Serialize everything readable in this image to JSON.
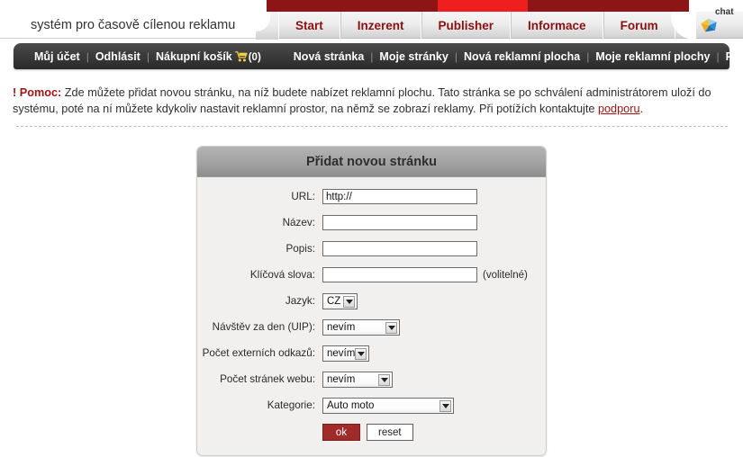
{
  "topbar": {
    "brand_text": "systém pro časově cílenou reklamu",
    "accent_dark_red": "#8e1515",
    "accent_bright_red": "#ef1f1f",
    "tabs": [
      {
        "label": "Start",
        "active": false
      },
      {
        "label": "Inzerent",
        "active": false
      },
      {
        "label": "Publisher",
        "active": true
      },
      {
        "label": "Informace",
        "active": false
      },
      {
        "label": "Forum",
        "active": false
      }
    ],
    "chat_label": "chat"
  },
  "subnav": {
    "left_items": [
      {
        "label": "Můj účet"
      },
      {
        "label": "Odhlásit"
      },
      {
        "label": "Nákupní košík"
      }
    ],
    "cart_count": "(0)",
    "separator": "|",
    "right_items": [
      {
        "label": "Nová stránka"
      },
      {
        "label": "Moje stránky"
      },
      {
        "label": "Nová reklamní plocha"
      },
      {
        "label": "Moje reklamní plochy"
      },
      {
        "label": "Poptávka webů"
      }
    ]
  },
  "help": {
    "prefix": "! Pomoc:",
    "body_before_link": " Zde můžete přidat novou stránku, na níž budete nabízet reklamní plochu. Tato stránka se po schválení administrátorem uloží do systému, poté na ní můžete kdykoliv nastavit reklamní prostor, na němž se zobrazí reklamy. Při potížích kontaktujte ",
    "link_text": "podporu",
    "body_after_link": "."
  },
  "form": {
    "title": "Přidat novou stránku",
    "fields": {
      "url": {
        "label": "URL:",
        "value": "http://"
      },
      "nazev": {
        "label": "Název:",
        "value": ""
      },
      "popis": {
        "label": "Popis:",
        "value": ""
      },
      "klicova_slova": {
        "label": "Klíčová slova:",
        "value": "",
        "note": "(volitelné)"
      },
      "jazyk": {
        "label": "Jazyk:",
        "value": "CZ"
      },
      "uip": {
        "label": "Návštěv za den (UIP):",
        "value": "nevím"
      },
      "odkazy": {
        "label": "Počet externích odkazů:",
        "value": "nevím"
      },
      "stranky": {
        "label": "Počet stránek webu:",
        "value": "nevím"
      },
      "kategorie": {
        "label": "Kategorie:",
        "value": "Auto moto"
      }
    },
    "buttons": {
      "ok": "ok",
      "reset": "reset"
    },
    "ok_color": "#a02b2b"
  }
}
